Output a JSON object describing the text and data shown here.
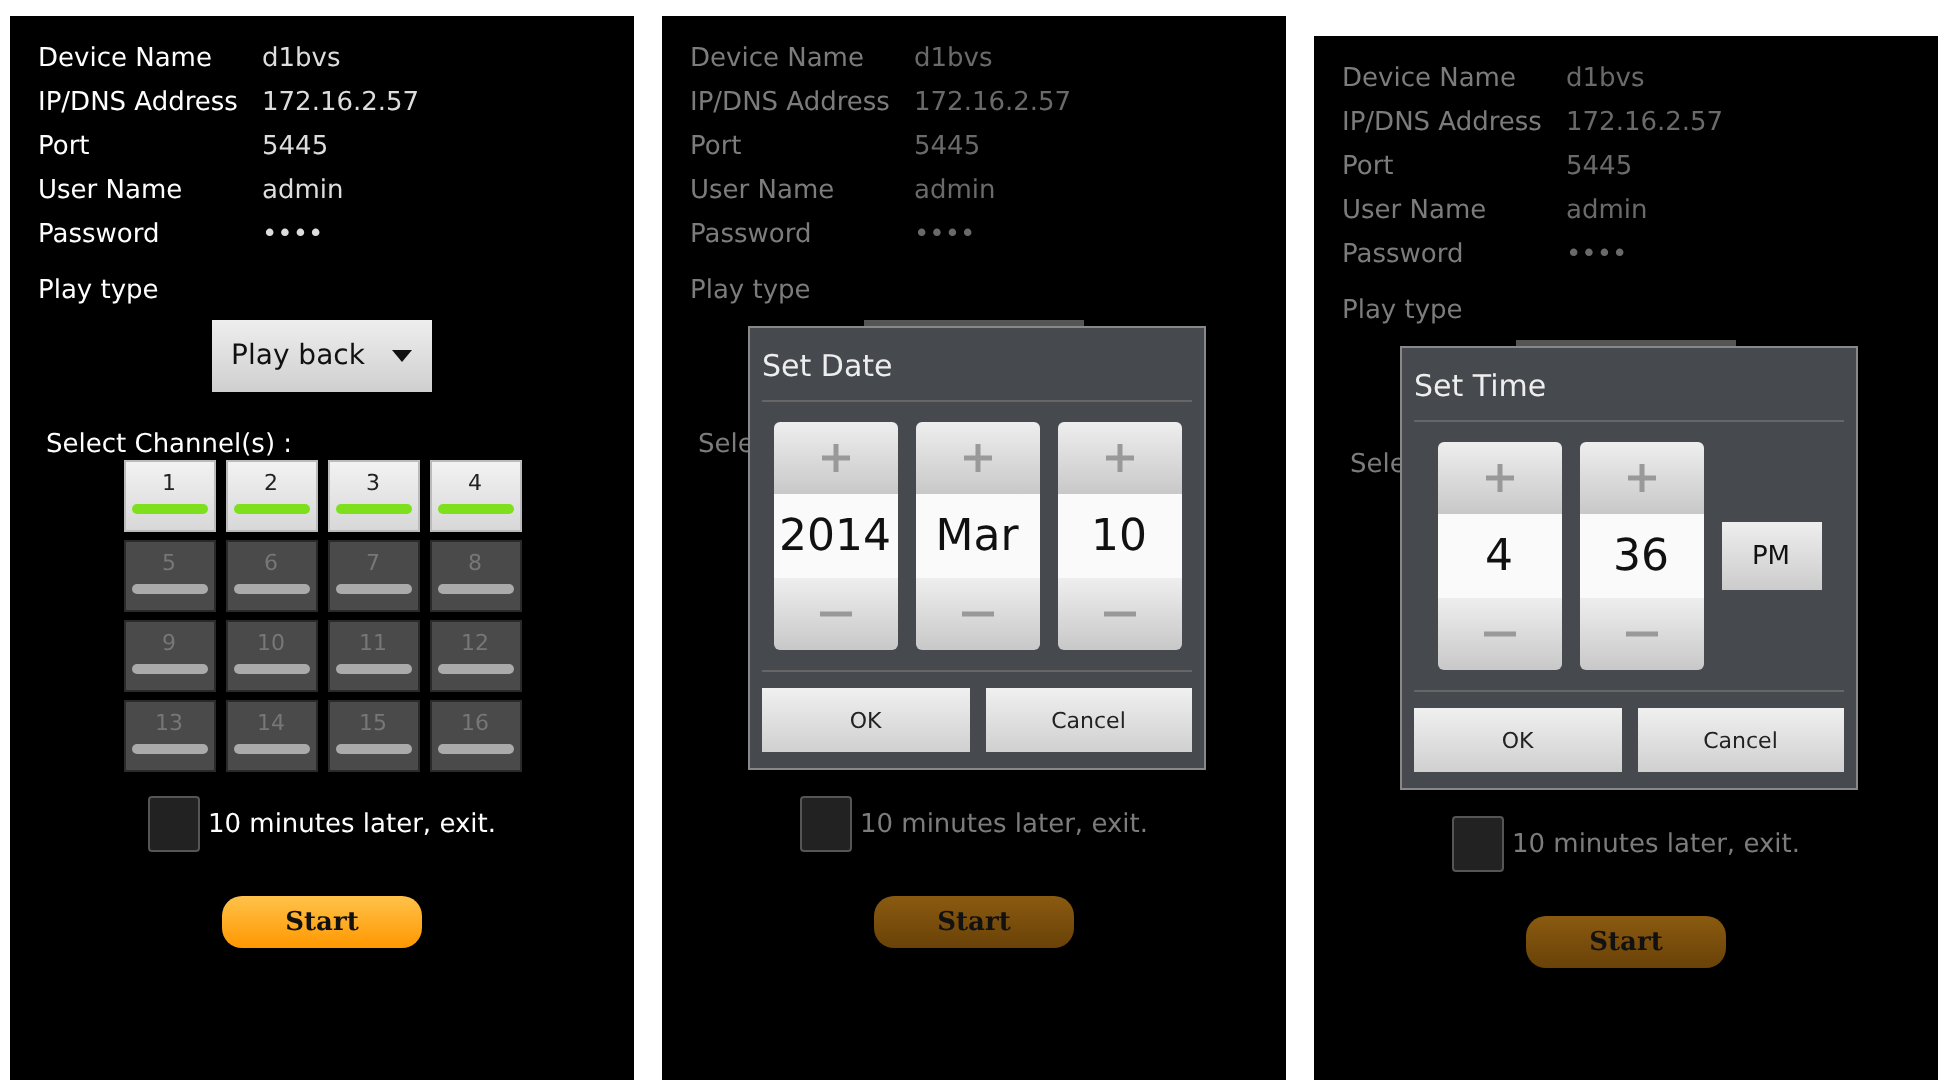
{
  "screens": [
    {
      "dimmed": false,
      "fields": [
        {
          "label": "Device Name",
          "value": "d1bvs"
        },
        {
          "label": "IP/DNS Address",
          "value": "172.16.2.57"
        },
        {
          "label": "Port",
          "value": "5445"
        },
        {
          "label": "User Name",
          "value": "admin"
        },
        {
          "label": "Password",
          "value": "••••"
        }
      ],
      "play_type_label": "Play type",
      "play_type_value": "Play back",
      "channel_label": "Select Channel(s) :",
      "channels": [
        {
          "label": "1",
          "selected": true
        },
        {
          "label": "2",
          "selected": true
        },
        {
          "label": "3",
          "selected": true
        },
        {
          "label": "4",
          "selected": true
        },
        {
          "label": "5",
          "selected": false
        },
        {
          "label": "6",
          "selected": false
        },
        {
          "label": "7",
          "selected": false
        },
        {
          "label": "8",
          "selected": false
        },
        {
          "label": "9",
          "selected": false
        },
        {
          "label": "10",
          "selected": false
        },
        {
          "label": "11",
          "selected": false
        },
        {
          "label": "12",
          "selected": false
        },
        {
          "label": "13",
          "selected": false
        },
        {
          "label": "14",
          "selected": false
        },
        {
          "label": "15",
          "selected": false
        },
        {
          "label": "16",
          "selected": false
        }
      ],
      "exit_option": {
        "label": "10 minutes later, exit.",
        "checked": false
      },
      "start_label": "Start"
    },
    {
      "dimmed": true,
      "fields": [
        {
          "label": "Device Name",
          "value": "d1bvs"
        },
        {
          "label": "IP/DNS Address",
          "value": "172.16.2.57"
        },
        {
          "label": "Port",
          "value": "5445"
        },
        {
          "label": "User Name",
          "value": "admin"
        },
        {
          "label": "Password",
          "value": "••••"
        }
      ],
      "play_type_label": "Play type",
      "channel_label": "Sele",
      "exit_option": {
        "label": "10 minutes later, exit.",
        "checked": false
      },
      "start_label": "Start",
      "dialog": {
        "title": "Set Date",
        "spinners": [
          {
            "value": "2014"
          },
          {
            "value": "Mar"
          },
          {
            "value": "10"
          }
        ],
        "buttons": [
          "OK",
          "Cancel"
        ]
      }
    },
    {
      "dimmed": true,
      "fields": [
        {
          "label": "Device Name",
          "value": "d1bvs"
        },
        {
          "label": "IP/DNS Address",
          "value": "172.16.2.57"
        },
        {
          "label": "Port",
          "value": "5445"
        },
        {
          "label": "User Name",
          "value": "admin"
        },
        {
          "label": "Password",
          "value": "••••"
        }
      ],
      "play_type_label": "Play type",
      "channel_label": "Sele",
      "exit_option": {
        "label": "10 minutes later, exit.",
        "checked": false
      },
      "start_label": "Start",
      "dialog": {
        "title": "Set Time",
        "spinners": [
          {
            "value": "4"
          },
          {
            "value": "36"
          }
        ],
        "toggle": "PM",
        "buttons": [
          "OK",
          "Cancel"
        ]
      }
    }
  ]
}
